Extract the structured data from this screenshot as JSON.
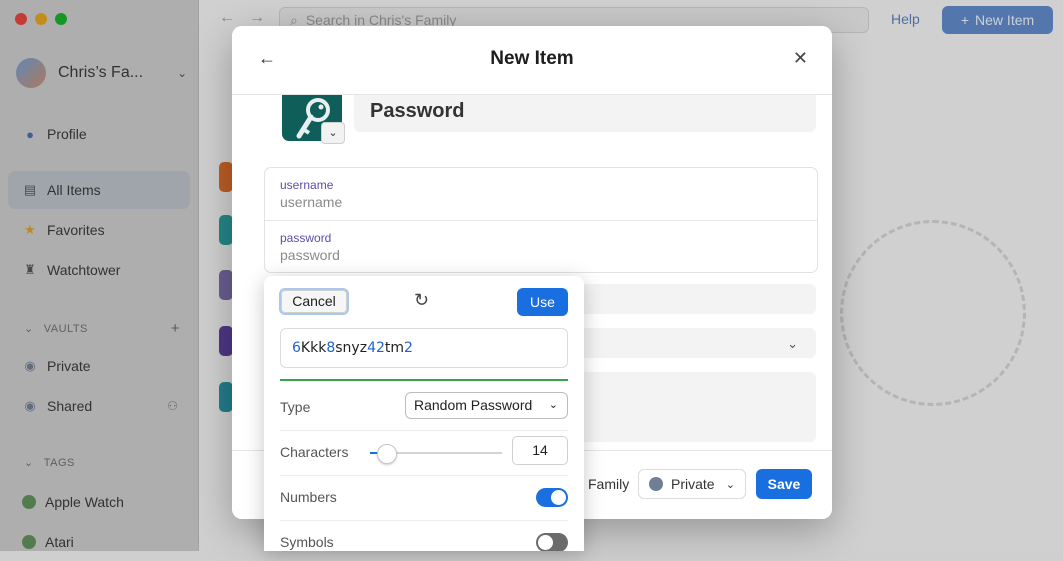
{
  "window": {
    "account_name": "Chris’s Fa...",
    "search_placeholder": "Search in Chris's Family",
    "help": "Help",
    "new_item": "New Item"
  },
  "sidebar": {
    "top_items": [
      {
        "label": "Profile",
        "icon": "person-icon"
      },
      {
        "label": "All Items",
        "icon": "list-icon",
        "active": true
      },
      {
        "label": "Favorites",
        "icon": "star-icon"
      },
      {
        "label": "Watchtower",
        "icon": "tower-icon"
      }
    ],
    "vaults_header": "VAULTS",
    "vaults": [
      {
        "label": "Private",
        "icon": "vault-icon"
      },
      {
        "label": "Shared",
        "icon": "vault-icon"
      }
    ],
    "tags_header": "TAGS",
    "tags": [
      {
        "label": "Apple Watch",
        "icon": "tag-icon"
      },
      {
        "label": "Atari",
        "icon": "tag-icon"
      }
    ]
  },
  "modal": {
    "title": "New Item",
    "item_title": "Password",
    "fields": [
      {
        "label": "username",
        "placeholder": "username"
      },
      {
        "label": "password",
        "placeholder": "password"
      }
    ],
    "footer": {
      "family_label": "Family",
      "vault_label": "Private",
      "save_label": "Save"
    }
  },
  "generator": {
    "cancel_label": "Cancel",
    "use_label": "Use",
    "password_parts": [
      {
        "t": "6",
        "digit": true
      },
      {
        "t": "Kkk",
        "digit": false
      },
      {
        "t": "8",
        "digit": true
      },
      {
        "t": "snyz",
        "digit": false
      },
      {
        "t": "42",
        "digit": true
      },
      {
        "t": "tm",
        "digit": false
      },
      {
        "t": "2",
        "digit": true
      }
    ],
    "type_label": "Type",
    "type_value": "Random Password",
    "characters_label": "Characters",
    "characters_value": "14",
    "characters_slider_fraction": 0.12,
    "numbers_label": "Numbers",
    "numbers_on": true,
    "symbols_label": "Symbols",
    "symbols_on": false,
    "colors": {
      "accent": "#1a6fe0",
      "strength": "#3aa247",
      "digit": "#2162c9"
    }
  }
}
